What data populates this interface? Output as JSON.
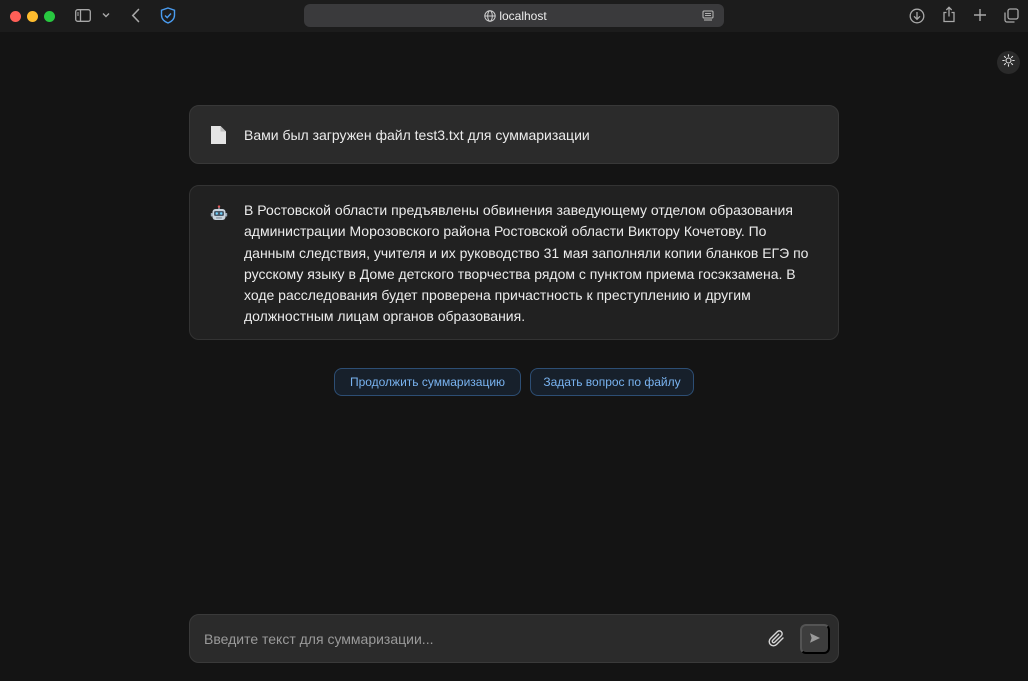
{
  "browser": {
    "url": "localhost",
    "icons": [
      "sidebar-icon",
      "chevron-down-icon",
      "back-icon",
      "shield-icon",
      "globe-icon",
      "reader-icon",
      "download-icon",
      "share-icon",
      "plus-icon",
      "tabs-icon"
    ]
  },
  "theme_toggle": {
    "icon": "sun-icon"
  },
  "messages": [
    {
      "role": "user",
      "icon": "file-icon",
      "text": "Вами был загружен файл test3.txt для суммаризации"
    },
    {
      "role": "bot",
      "icon": "robot-icon",
      "text": "В Ростовской области предъявлены обвинения заведующему отделом образования администрации Морозовского района Ростовской области Виктору Кочетову. По данным следствия, учителя и их руководство 31 мая заполняли копии бланков ЕГЭ по русскому языку в Доме детского творчества рядом с пунктом приема госэкзамена. В ходе расследования будет проверена причастность к преступлению и другим должностным лицам органов образования."
    }
  ],
  "actions": {
    "continue_label": "Продолжить суммаризацию",
    "ask_label": "Задать вопрос по файлу"
  },
  "input": {
    "placeholder": "Введите текст для суммаризации...",
    "value": "",
    "attach_icon": "paperclip-icon",
    "send_icon": "send-icon"
  },
  "colors": {
    "background": "#141414",
    "accent": "#79b3f0",
    "bubble": "#212121"
  }
}
